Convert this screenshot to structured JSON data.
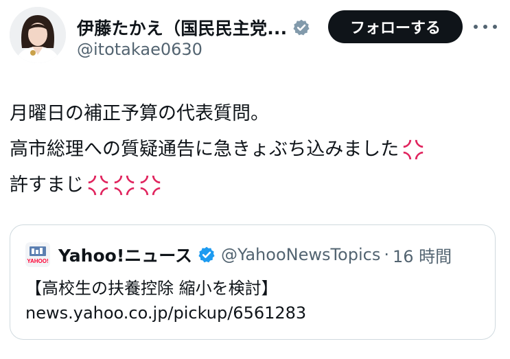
{
  "author": {
    "display_name": "伊藤たかえ（国民民主党...",
    "handle": "@itotakae0630",
    "avatar": "avatar-photo",
    "verified_icon": "verified-badge-icon",
    "verified_color": "#829aab"
  },
  "actions": {
    "follow_label": "フォローする",
    "more_icon": "more-options-icon"
  },
  "tweet": {
    "lines": [
      "月曜日の補正予算の代表質問。",
      "高市総理への質疑通告に急きょぶち込みました",
      "許すまじ"
    ],
    "emoji_icon": "anger-symbol-icon",
    "emoji_color": "#e0245e"
  },
  "quote": {
    "display_name": "Yahoo!ニュース",
    "handle": "@YahooNewsTopics",
    "separator": "·",
    "time": "16 時間",
    "logo_icon": "yahoo-news-logo-icon",
    "logo_text": "YAHOO!",
    "verified_color": "#1d9bf0",
    "line1": "【高校生の扶養控除 縮小を検討】",
    "line2": "news.yahoo.co.jp/pickup/6561283"
  }
}
